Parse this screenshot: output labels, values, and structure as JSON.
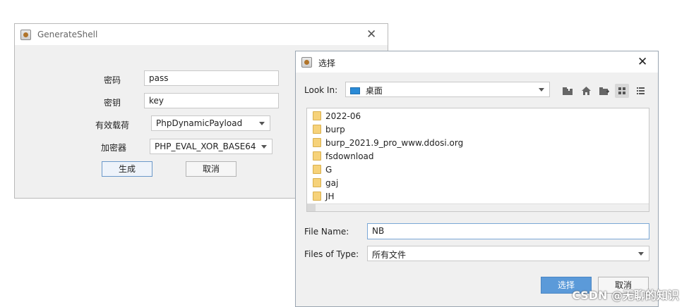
{
  "generate_window": {
    "title": "GenerateShell",
    "close_glyph": "✕",
    "password_label": "密码",
    "password_value": "pass",
    "key_label": "密钥",
    "key_value": "key",
    "payload_label": "有效载荷",
    "payload_value": "PhpDynamicPayload",
    "encoder_label": "加密器",
    "encoder_value": "PHP_EVAL_XOR_BASE64",
    "generate_button": "生成",
    "cancel_button": "取消"
  },
  "file_dialog": {
    "title": "选择",
    "close_glyph": "✕",
    "look_in_label": "Look In:",
    "look_in_value": "桌面",
    "files": [
      "2022-06",
      "burp",
      "burp_2021.9_pro_www.ddosi.org",
      "fsdownload",
      "G",
      "gaj",
      "JH"
    ],
    "file_name_label": "File Name:",
    "file_name_value": "NB",
    "files_of_type_label": "Files of Type:",
    "files_of_type_value": "所有文件",
    "select_button": "选择",
    "cancel_button": "取消"
  },
  "watermark": "CSDN @无聊的知识",
  "icons": [
    "java-app-icon",
    "up-folder-icon",
    "home-icon",
    "new-folder-icon",
    "list-view-icon",
    "details-view-icon",
    "folder-icon"
  ],
  "colors": {
    "primary": "#5b9ad9",
    "window_bg": "#f0f0f0",
    "folder": "#f6d27a"
  }
}
